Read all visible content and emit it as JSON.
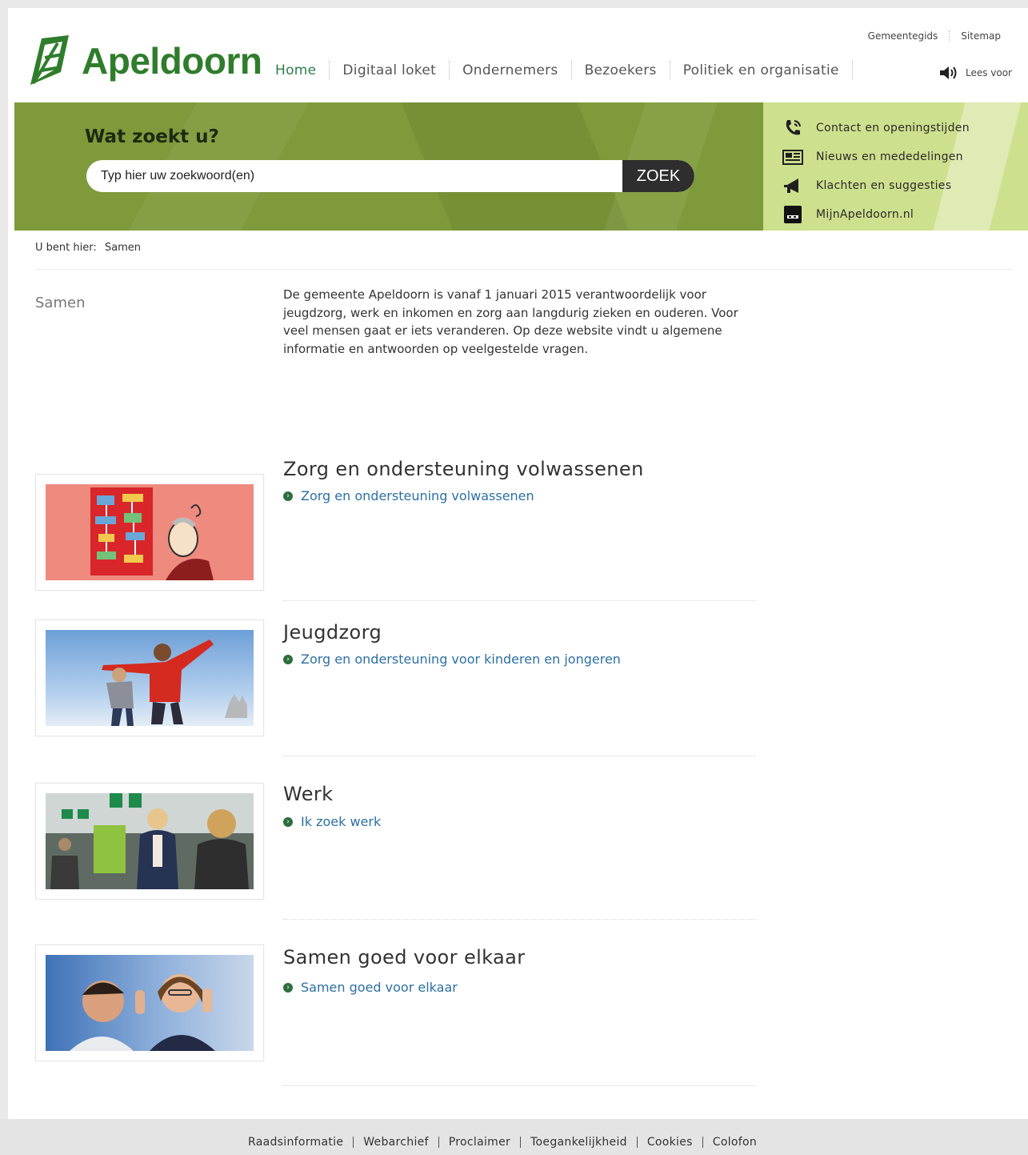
{
  "header": {
    "logo_text": "Apeldoorn",
    "nav": [
      "Home",
      "Digitaal loket",
      "Ondernemers",
      "Bezoekers",
      "Politiek en organisatie"
    ],
    "utility": [
      "Gemeentegids",
      "Sitemap"
    ],
    "read_aloud": "Lees voor"
  },
  "search": {
    "title": "Wat zoekt u?",
    "placeholder": "Typ hier uw zoekwoord(en)",
    "button": "ZOEK"
  },
  "quick_links": [
    {
      "label": "Contact en openingstijden",
      "icon": "phone-icon"
    },
    {
      "label": "Nieuws en mededelingen",
      "icon": "newspaper-icon"
    },
    {
      "label": "Klachten en suggesties",
      "icon": "megaphone-icon"
    },
    {
      "label": "MijnApeldoorn.nl",
      "icon": "digid-icon"
    }
  ],
  "breadcrumb": {
    "prefix": "U bent hier:",
    "current": "Samen"
  },
  "sidebar": {
    "title": "Samen"
  },
  "intro": "De gemeente Apeldoorn is vanaf 1 januari 2015 verantwoordelijk voor jeugdzorg, werk en inkomen en zorg aan langdurig zieken en ouderen. Voor veel mensen gaat er iets veranderen. Op deze website vindt u algemene informatie en antwoorden op veelgestelde vragen.",
  "sections": [
    {
      "title": "Zorg en ondersteuning volwassenen",
      "link": "Zorg en ondersteuning volwassenen"
    },
    {
      "title": "Jeugdzorg",
      "link": "Zorg en ondersteuning voor kinderen en jongeren"
    },
    {
      "title": "Werk",
      "link": "Ik zoek werk"
    },
    {
      "title": "Samen goed voor elkaar",
      "link": "Samen goed voor elkaar"
    }
  ],
  "footer": [
    "Raadsinformatie",
    "Webarchief",
    "Proclaimer",
    "Toegankelijkheid",
    "Cookies",
    "Colofon"
  ],
  "colors": {
    "brand_green": "#2f7d2c",
    "band_green": "#7e9a3a",
    "quick_green": "#cde08d",
    "link_blue": "#2d6fa3"
  }
}
